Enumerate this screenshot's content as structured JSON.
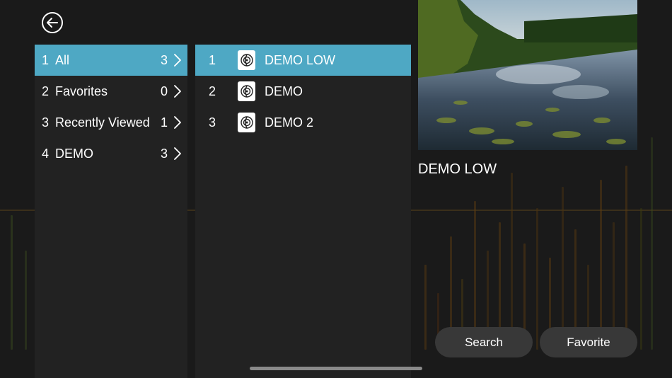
{
  "categories": [
    {
      "num": "1",
      "label": "All",
      "count": "3",
      "selected": true
    },
    {
      "num": "2",
      "label": "Favorites",
      "count": "0",
      "selected": false
    },
    {
      "num": "3",
      "label": "Recently Viewed",
      "count": "1",
      "selected": false
    },
    {
      "num": "4",
      "label": "DEMO",
      "count": "3",
      "selected": false
    }
  ],
  "items": [
    {
      "num": "1",
      "label": "DEMO LOW",
      "selected": true
    },
    {
      "num": "2",
      "label": "DEMO",
      "selected": false
    },
    {
      "num": "3",
      "label": "DEMO 2",
      "selected": false
    }
  ],
  "preview": {
    "title": "DEMO LOW"
  },
  "buttons": {
    "search": "Search",
    "favorite": "Favorite"
  },
  "icons": {
    "back": "back-arrow-icon",
    "chevron": "chevron-right-icon",
    "thumb": "media-logo-icon"
  },
  "colors": {
    "accent": "#4ea8c4",
    "background": "#1a1a1a",
    "panel": "#222222",
    "button": "#383838"
  }
}
